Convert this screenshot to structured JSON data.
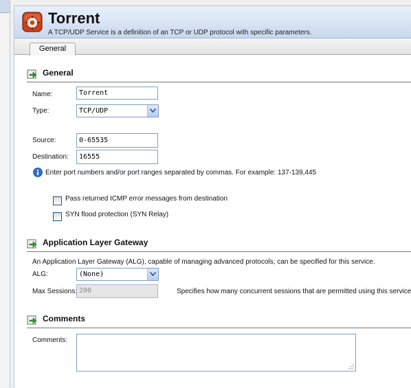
{
  "header": {
    "title": "Torrent",
    "subtitle": "A TCP/UDP Service is a definition of an TCP or UDP protocol with specific parameters.",
    "icon": "service-icon"
  },
  "tabs": [
    {
      "label": "General",
      "active": true
    }
  ],
  "general": {
    "heading": "General",
    "name_label": "Name:",
    "name_value": "Torrent",
    "type_label": "Type:",
    "type_value": "TCP/UDP",
    "source_label": "Source:",
    "source_value": "0-65535",
    "destination_label": "Destination:",
    "destination_value": "16555",
    "info_text": "Enter port numbers and/or port ranges separated by commas. For example: 137-139,445",
    "icmp_label": "Pass returned ICMP error messages from destination",
    "icmp_checked": false,
    "syn_label": "SYN flood protection (SYN Relay)",
    "syn_checked": false
  },
  "alg": {
    "heading": "Application Layer Gateway",
    "description": "An Application Layer Gateway (ALG), capable of managing advanced protocols, can be specified for this service.",
    "alg_label": "ALG:",
    "alg_value": "(None)",
    "max_sessions_label": "Max Sessions:",
    "max_sessions_value": "200",
    "max_sessions_help": "Specifies how many concurrent sessions that are permitted using this service."
  },
  "comments": {
    "heading": "Comments",
    "comments_label": "Comments:",
    "comments_value": ""
  },
  "colors": {
    "header_gradient_top": "#e9f0fa",
    "header_gradient_bottom": "#c9d8ee",
    "section_rule": "#777777",
    "input_border": "#7f9db9"
  }
}
